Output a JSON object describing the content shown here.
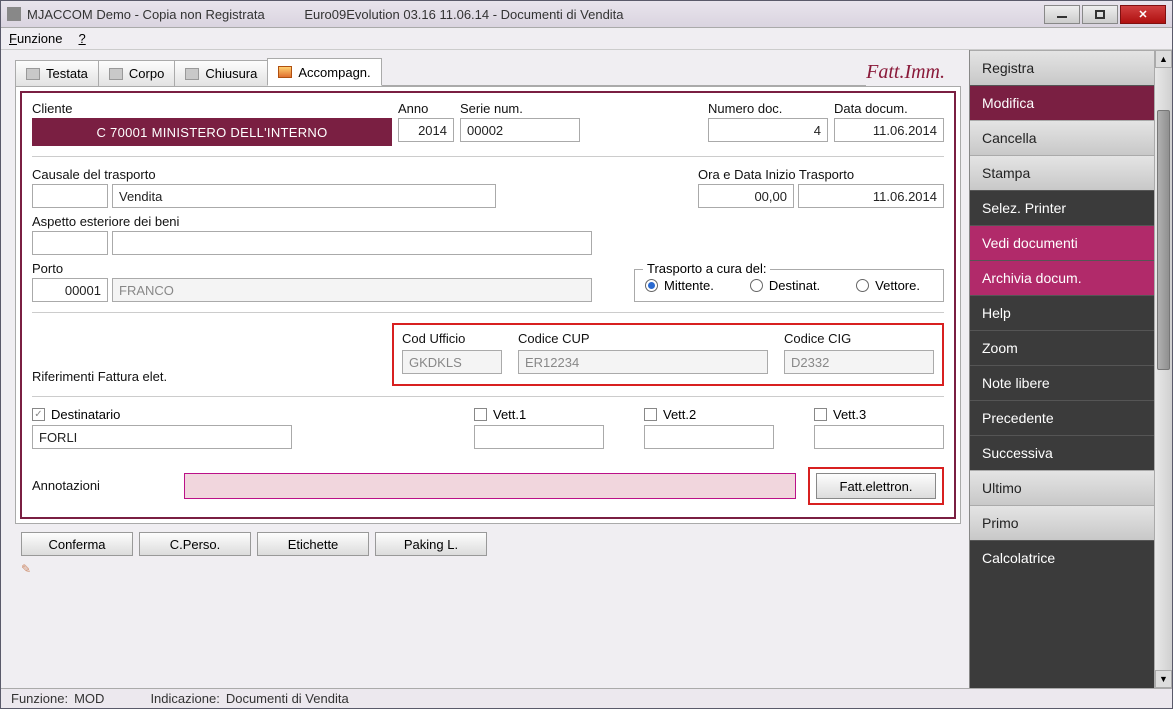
{
  "title": {
    "app": "MJACCOM  Demo - Copia non Registrata",
    "module": "Euro09Evolution 03.16 11.06.14 -  Documenti di Vendita"
  },
  "menu": {
    "funzione": "Funzione",
    "help": "?"
  },
  "tabs": {
    "testata": "Testata",
    "corpo": "Corpo",
    "chiusura": "Chiusura",
    "accompagn": "Accompagn."
  },
  "fattimm": "Fatt.Imm.",
  "labels": {
    "cliente": "Cliente",
    "anno": "Anno",
    "serie": "Serie num.",
    "numdoc": "Numero doc.",
    "datadoc": "Data docum.",
    "causale": "Causale del trasporto",
    "oradata": "Ora e Data Inizio Trasporto",
    "aspetto": "Aspetto esteriore dei beni",
    "porto": "Porto",
    "trasportocura": "Trasporto a cura del:",
    "mittente": "Mittente.",
    "destinat": "Destinat.",
    "vettore": "Vettore.",
    "rif": "Riferimenti Fattura elet.",
    "codufficio": "Cod Ufficio",
    "codcup": "Codice CUP",
    "codcig": "Codice CIG",
    "destinatario": "Destinatario",
    "vett1": "Vett.1",
    "vett2": "Vett.2",
    "vett3": "Vett.3",
    "annotazioni": "Annotazioni",
    "fattelettron": "Fatt.elettron."
  },
  "values": {
    "cliente": "C   70001   MINISTERO DELL'INTERNO",
    "anno": "2014",
    "serie": "00002",
    "numdoc": "4",
    "datadoc": "11.06.2014",
    "causale_code": "",
    "causale_desc": "Vendita",
    "ora": "00,00",
    "datatrasp": "11.06.2014",
    "aspetto_code": "",
    "aspetto_desc": "",
    "porto_code": "00001",
    "porto_desc": "FRANCO",
    "codufficio": "GKDKLS",
    "codcup": "ER12234",
    "codcig": "D2332",
    "destinatario": "FORLI",
    "vett1": "",
    "vett2": "",
    "vett3": "",
    "annotazioni": ""
  },
  "sidebar": [
    {
      "label": "Registra",
      "style": "light"
    },
    {
      "label": "Modifica",
      "style": "maroon"
    },
    {
      "label": "Cancella",
      "style": "light"
    },
    {
      "label": "Stampa",
      "style": "light"
    },
    {
      "label": "Selez. Printer",
      "style": "dark"
    },
    {
      "label": "Vedi documenti",
      "style": "bright"
    },
    {
      "label": "Archivia docum.",
      "style": "bright"
    },
    {
      "label": "Help",
      "style": "dark"
    },
    {
      "label": "Zoom",
      "style": "dark"
    },
    {
      "label": "Note libere",
      "style": "dark"
    },
    {
      "label": "Precedente",
      "style": "dark"
    },
    {
      "label": "Successiva",
      "style": "dark"
    },
    {
      "label": "Ultimo",
      "style": "light"
    },
    {
      "label": "Primo",
      "style": "light"
    },
    {
      "label": "Calcolatrice",
      "style": "dark"
    }
  ],
  "bottom": {
    "conferma": "Conferma",
    "cperso": "C.Perso.",
    "etichette": "Etichette",
    "paking": "Paking L."
  },
  "status": {
    "k1": "Funzione:",
    "v1": "MOD",
    "k2": "Indicazione:",
    "v2": "Documenti di Vendita"
  }
}
